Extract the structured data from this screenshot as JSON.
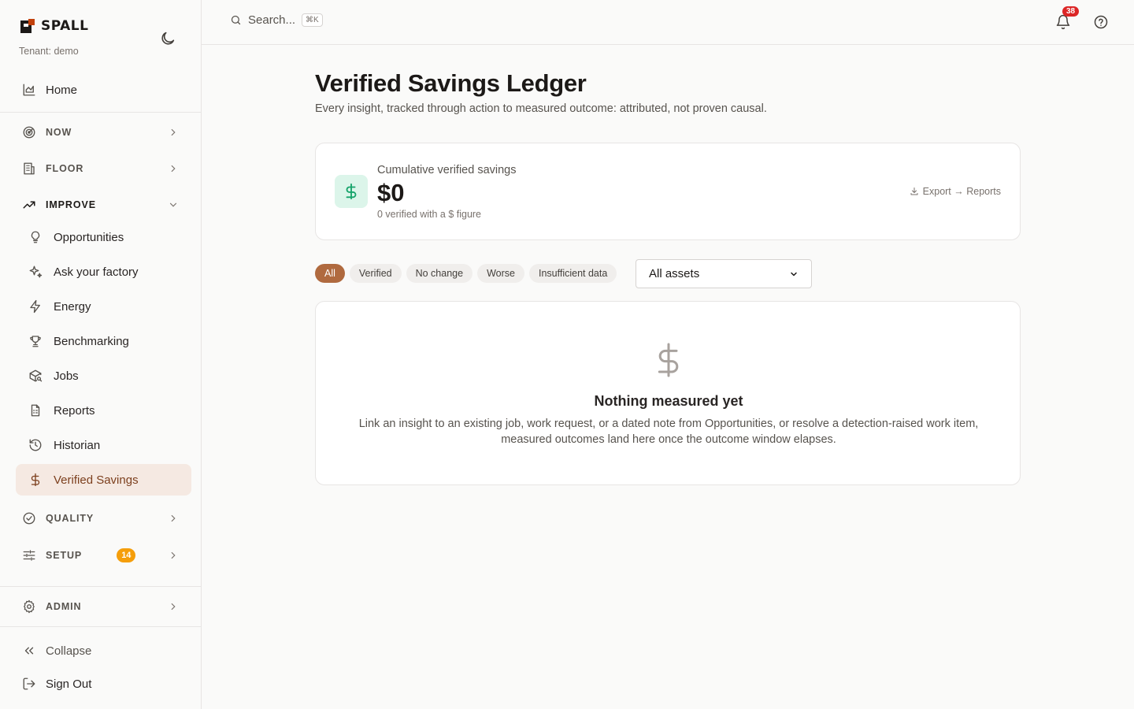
{
  "brand": {
    "name": "SPALL",
    "tenant": "Tenant: demo",
    "accent": "#c2410c"
  },
  "topbar": {
    "search_placeholder": "Search...",
    "shortcut": "⌘K",
    "notifications_count": "38"
  },
  "sidebar": {
    "home": "Home",
    "sections": {
      "now": "NOW",
      "floor": "FLOOR",
      "improve": "IMPROVE",
      "quality": "QUALITY",
      "setup": "SETUP",
      "admin": "ADMIN"
    },
    "setup_badge": "14",
    "improve_items": [
      {
        "label": "Opportunities",
        "icon": "lightbulb-icon"
      },
      {
        "label": "Ask your factory",
        "icon": "sparkles-icon"
      },
      {
        "label": "Energy",
        "icon": "zap-icon"
      },
      {
        "label": "Benchmarking",
        "icon": "trophy-icon"
      },
      {
        "label": "Jobs",
        "icon": "package-search-icon"
      },
      {
        "label": "Reports",
        "icon": "file-spreadsheet-icon"
      },
      {
        "label": "Historian",
        "icon": "history-icon"
      },
      {
        "label": "Verified Savings",
        "icon": "dollar-icon"
      }
    ],
    "collapse": "Collapse",
    "sign_out": "Sign Out"
  },
  "page": {
    "title": "Verified Savings Ledger",
    "subtitle": "Every insight, tracked through action to measured outcome: attributed, not proven causal."
  },
  "summary": {
    "label": "Cumulative verified savings",
    "value": "$0",
    "note": "0 verified with a $ figure",
    "export": "Export → Reports"
  },
  "filters": {
    "chips": [
      "All",
      "Verified",
      "No change",
      "Worse",
      "Insufficient data"
    ],
    "selected_chip": "All",
    "asset_select": "All assets"
  },
  "empty_state": {
    "title": "Nothing measured yet",
    "body_line1": "Link an insight to an existing job, work request, or a dated note from Opportunities, or resolve a detection-raised work item,",
    "body_line2": "measured outcomes land here once the outcome window elapses."
  }
}
